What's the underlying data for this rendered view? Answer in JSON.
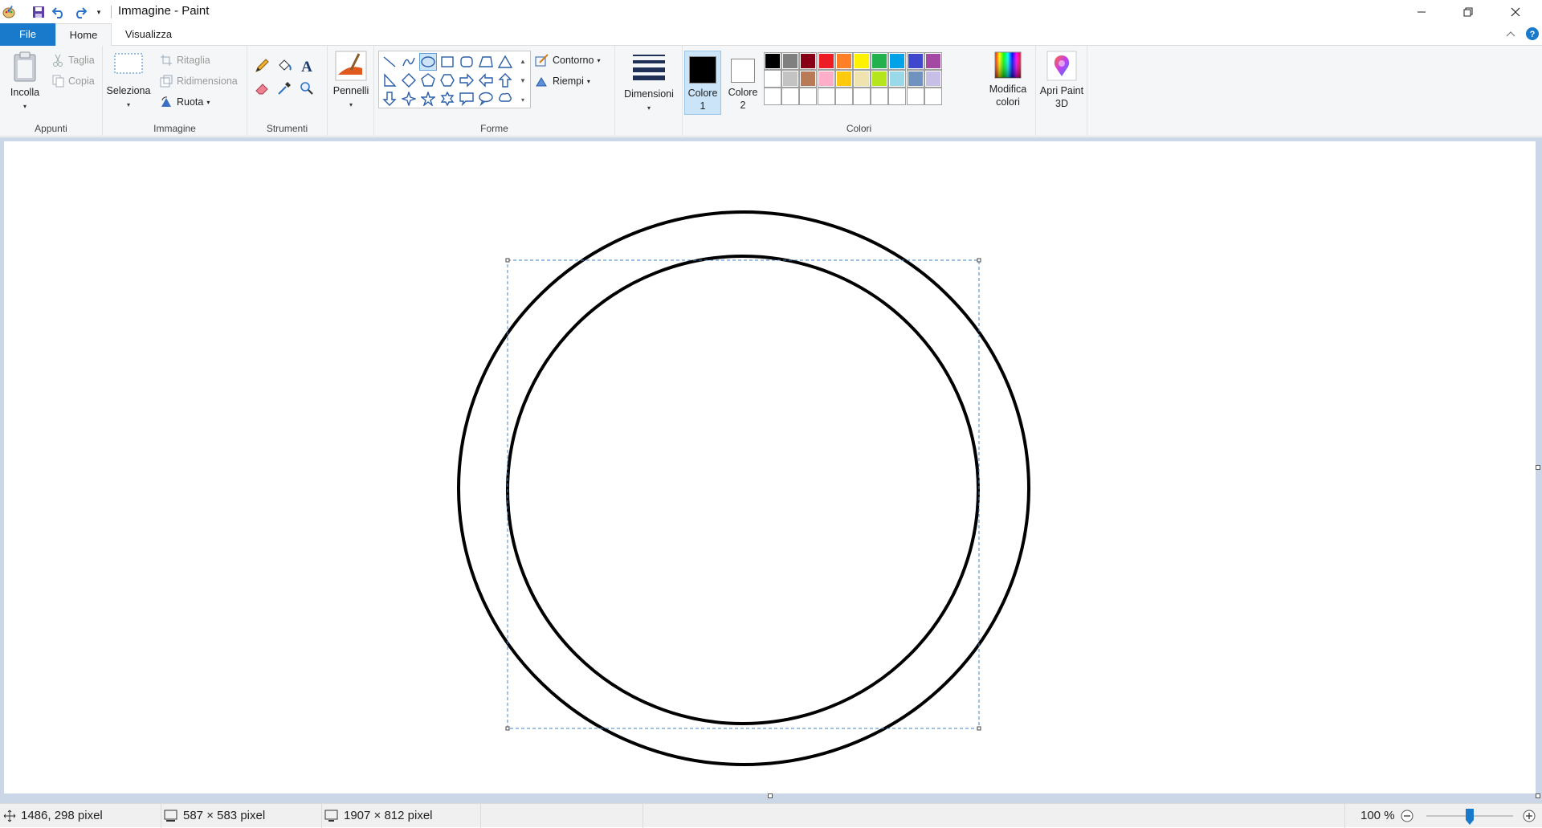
{
  "window": {
    "title": "Immagine - Paint",
    "quick_access": [
      "paint-logo-icon",
      "save-icon",
      "undo-icon",
      "redo-icon",
      "customize-quick-access-icon"
    ],
    "controls": [
      "minimize",
      "restore",
      "close"
    ]
  },
  "tabs": {
    "file": "File",
    "home": "Home",
    "view": "Visualizza"
  },
  "ribbon": {
    "clipboard": {
      "label": "Appunti",
      "paste": "Incolla",
      "cut": "Taglia",
      "copy": "Copia"
    },
    "image": {
      "label": "Immagine",
      "select": "Seleziona",
      "crop": "Ritaglia",
      "resize": "Ridimensiona",
      "rotate": "Ruota"
    },
    "tools": {
      "label": "Strumenti",
      "items": [
        "pencil",
        "fill",
        "text",
        "eraser",
        "color-picker",
        "magnifier"
      ]
    },
    "brushes": {
      "label": "Pennelli"
    },
    "shapes": {
      "label": "Forme",
      "outline": "Contorno",
      "fill": "Riempi",
      "selected_shape": "oval"
    },
    "size": {
      "label": "Dimensioni"
    },
    "colors": {
      "label": "Colori",
      "color1": "Colore 1",
      "color2": "Colore 2",
      "color1_value": "#000000",
      "color2_value": "#ffffff",
      "edit_colors": "Modifica colori",
      "palette_row1": [
        "#000000",
        "#7f7f7f",
        "#880015",
        "#ed1c24",
        "#ff7f27",
        "#fff200",
        "#22b14c",
        "#00a2e8",
        "#3f48cc",
        "#a349a4"
      ],
      "palette_row2": [
        "#ffffff",
        "#c3c3c3",
        "#b97a57",
        "#ffaec9",
        "#ffc90e",
        "#efe4b0",
        "#b5e61d",
        "#99d9ea",
        "#7092be",
        "#c8bfe7"
      ],
      "palette_row3": [
        "#ffffff",
        "#ffffff",
        "#ffffff",
        "#ffffff",
        "#ffffff",
        "#ffffff",
        "#ffffff",
        "#ffffff",
        "#ffffff",
        "#ffffff"
      ]
    },
    "paint3d": {
      "label": "Apri Paint 3D"
    }
  },
  "status": {
    "cursor_position": "1486, 298 pixel",
    "selection_size": "587 × 583 pixel",
    "image_size": "1907 × 812 pixel",
    "zoom": "100 %",
    "zoom_level": 1.0
  }
}
